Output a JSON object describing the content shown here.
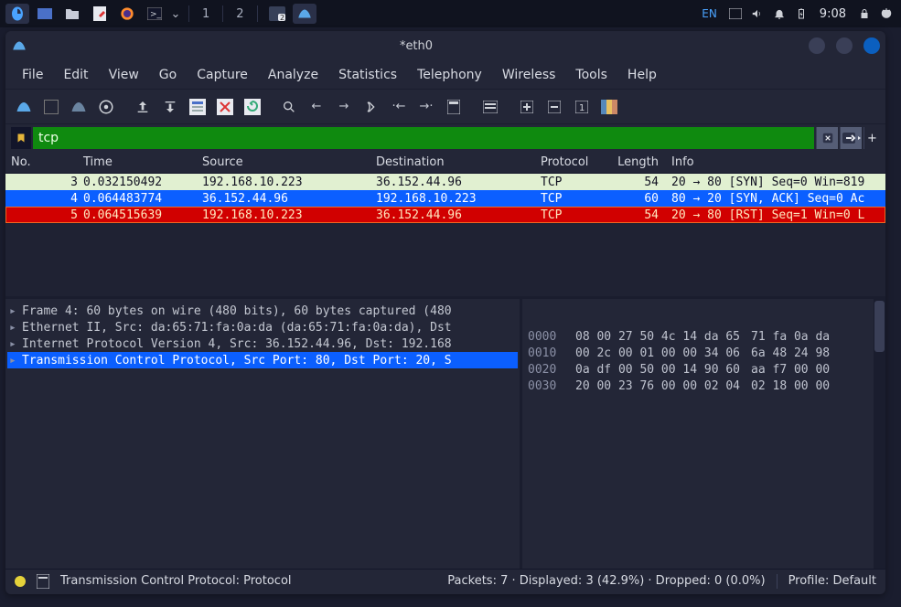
{
  "taskbar": {
    "workspaces": [
      "1",
      "2"
    ],
    "indicator": "2",
    "lang": "EN",
    "time": "9:08"
  },
  "window": {
    "title": "*eth0"
  },
  "menu": [
    "File",
    "Edit",
    "View",
    "Go",
    "Capture",
    "Analyze",
    "Statistics",
    "Telephony",
    "Wireless",
    "Tools",
    "Help"
  ],
  "filter": {
    "value": "tcp"
  },
  "packet_list": {
    "columns": [
      "No.",
      "Time",
      "Source",
      "Destination",
      "Protocol",
      "Length",
      "Info"
    ],
    "rows": [
      {
        "no": "3",
        "time": "0.032150492",
        "src": "192.168.10.223",
        "dst": "36.152.44.96",
        "proto": "TCP",
        "len": "54",
        "info": "20 → 80 [SYN] Seq=0 Win=819",
        "style": "normal"
      },
      {
        "no": "4",
        "time": "0.064483774",
        "src": "36.152.44.96",
        "dst": "192.168.10.223",
        "proto": "TCP",
        "len": "60",
        "info": "80 → 20 [SYN, ACK] Seq=0 Ac",
        "style": "selected"
      },
      {
        "no": "5",
        "time": "0.064515639",
        "src": "192.168.10.223",
        "dst": "36.152.44.96",
        "proto": "TCP",
        "len": "54",
        "info": "20 → 80 [RST] Seq=1 Win=0 L",
        "style": "error"
      }
    ]
  },
  "details": [
    {
      "text": "Frame 4: 60 bytes on wire (480 bits), 60 bytes captured (480",
      "sel": false
    },
    {
      "text": "Ethernet II, Src: da:65:71:fa:0a:da (da:65:71:fa:0a:da), Dst",
      "sel": false
    },
    {
      "text": "Internet Protocol Version 4, Src: 36.152.44.96, Dst: 192.168",
      "sel": false
    },
    {
      "text": "Transmission Control Protocol, Src Port: 80, Dst Port: 20, S",
      "sel": true
    }
  ],
  "hex": [
    {
      "off": "0000",
      "b1": "08 00 27 50 4c 14 da 65",
      "b2": "71 fa 0a da"
    },
    {
      "off": "0010",
      "b1": "00 2c 00 01 00 00 34 06",
      "b2": "6a 48 24 98"
    },
    {
      "off": "0020",
      "b1": "0a df 00 50 00 14 90 60",
      "b2": "aa f7 00 00"
    },
    {
      "off": "0030",
      "b1": "20 00 23 76 00 00 02 04",
      "b2": "02 18 00 00"
    }
  ],
  "status": {
    "left": "Transmission Control Protocol: Protocol",
    "center": "Packets: 7 · Displayed: 3 (42.9%) · Dropped: 0 (0.0%)",
    "right": "Profile: Default"
  }
}
